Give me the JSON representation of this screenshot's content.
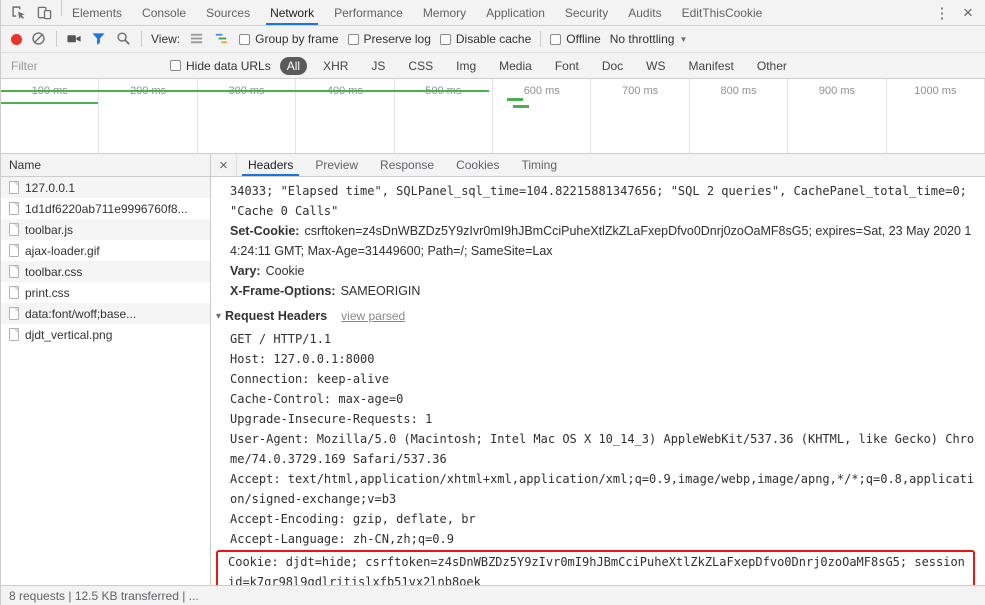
{
  "colors": {
    "accent_blue": "#1a73e8",
    "record_red": "#e8342a",
    "filter_blue": "#1a73e8",
    "timeline_green": "#4caf50",
    "highlight_red": "#ef1311",
    "toolbar_bg": "#f3f3f3"
  },
  "top_bar": {
    "tabs": [
      "Elements",
      "Console",
      "Sources",
      "Network",
      "Performance",
      "Memory",
      "Application",
      "Security",
      "Audits",
      "EditThisCookie"
    ],
    "active_tab": "Network",
    "kebab_icon": "⋮",
    "close_icon": "×"
  },
  "toolbar": {
    "view_label": "View:",
    "group_by_frame": "Group by frame",
    "preserve_log": "Preserve log",
    "disable_cache": "Disable cache",
    "offline": "Offline",
    "throttling": "No throttling",
    "dropdown_icon": "▼"
  },
  "filter_bar": {
    "placeholder": "Filter",
    "hide_data_urls": "Hide data URLs",
    "types": [
      "All",
      "XHR",
      "JS",
      "CSS",
      "Img",
      "Media",
      "Font",
      "Doc",
      "WS",
      "Manifest",
      "Other"
    ],
    "active_type": "All"
  },
  "timeline": {
    "ticks": [
      "100 ms",
      "200 ms",
      "300 ms",
      "400 ms",
      "500 ms",
      "600 ms",
      "700 ms",
      "800 ms",
      "900 ms",
      "1000 ms"
    ]
  },
  "requests": {
    "name_header": "Name",
    "items": [
      {
        "name": "127.0.0.1"
      },
      {
        "name": "1d1df6220ab711e9996760f8..."
      },
      {
        "name": "toolbar.js"
      },
      {
        "name": "ajax-loader.gif"
      },
      {
        "name": "toolbar.css"
      },
      {
        "name": "print.css"
      },
      {
        "name": "data:font/woff;base..."
      },
      {
        "name": "djdt_vertical.png"
      }
    ]
  },
  "headers_panel": {
    "close_icon": "×",
    "tabs": [
      "Headers",
      "Preview",
      "Response",
      "Cookies",
      "Timing"
    ],
    "active_tab": "Headers",
    "response_tail": [
      {
        "text": "34033; \"Elapsed time\", SQLPanel_sql_time=104.82215881347656; \"SQL 2 queries\", CachePanel_total_time=0; \"Cache 0 Calls\""
      },
      {
        "name": "Set-Cookie:",
        "value": "csrftoken=z4sDnWBZDz5Y9zIvr0mI9hJBmCciPuheXtlZkZLaFxepDfvo0Dnrj0zoOaMF8sG5; expires=Sat, 23 May 2020 14:24:11 GMT; Max-Age=31449600; Path=/; SameSite=Lax"
      },
      {
        "name": "Vary:",
        "value": "Cookie"
      },
      {
        "name": "X-Frame-Options:",
        "value": "SAMEORIGIN"
      }
    ],
    "request_headers": {
      "disclosure_icon": "▾",
      "title": "Request Headers",
      "view_toggle": "view parsed",
      "raw_lines": [
        "GET / HTTP/1.1",
        "Host: 127.0.0.1:8000",
        "Connection: keep-alive",
        "Cache-Control: max-age=0",
        "Upgrade-Insecure-Requests: 1",
        "User-Agent: Mozilla/5.0 (Macintosh; Intel Mac OS X 10_14_3) AppleWebKit/537.36 (KHTML, like Gecko) Chrome/74.0.3729.169 Safari/537.36",
        "Accept: text/html,application/xhtml+xml,application/xml;q=0.9,image/webp,image/apng,*/*;q=0.8,application/signed-exchange;v=b3",
        "Accept-Encoding: gzip, deflate, br",
        "Accept-Language: zh-CN,zh;q=0.9"
      ],
      "cookie_line": "Cookie: djdt=hide; csrftoken=z4sDnWBZDz5Y9zIvr0mI9hJBmCciPuheXtlZkZLaFxepDfvo0Dnrj0zoOaMF8sG5; sessionid=k7qr98l9gdlritjslxfb51vx2lnb8oek"
    }
  },
  "status_bar": {
    "text": "8 requests | 12.5 KB transferred | ..."
  }
}
